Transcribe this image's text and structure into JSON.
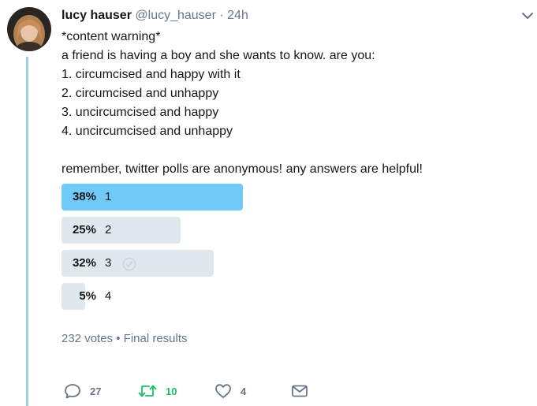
{
  "tweet": {
    "name": "lucy hauser",
    "handle": "@lucy_hauser",
    "separator": "·",
    "time": "24h",
    "lines": [
      "*content warning*",
      "a friend is having a boy and she wants to know. are you:",
      "1. circumcised and happy with it",
      "2. circumcised and unhappy",
      "3. uncircumcised and happy",
      "4. uncircumcised and unhappy",
      "",
      "remember, twitter polls are anonymous! any answers are helpful!"
    ]
  },
  "poll": {
    "options": [
      {
        "percent_label": "38%",
        "label": "1",
        "percent": 38,
        "winner": true
      },
      {
        "percent_label": "25%",
        "label": "2",
        "percent": 25,
        "winner": false
      },
      {
        "percent_label": "32%",
        "label": "3",
        "percent": 32,
        "winner": false
      },
      {
        "percent_label": "5%",
        "label": "4",
        "percent": 5,
        "winner": false
      }
    ],
    "votes": "232 votes",
    "meta_separator": "•",
    "status": "Final results"
  },
  "actions": {
    "reply_count": "27",
    "retweet_count": "10",
    "like_count": "4"
  },
  "colors": {
    "winner_bar": "#71c9f8",
    "other_bar": "#e1e8ed",
    "retweet": "#17bf63",
    "muted": "#657786"
  }
}
